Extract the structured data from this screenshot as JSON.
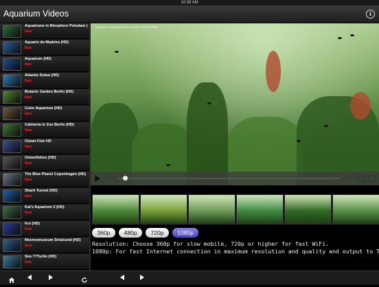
{
  "status": {
    "time": "10:38 AM",
    "carrier": "",
    "battery": ""
  },
  "header": {
    "title": "Aquarium Videos",
    "info_icon": "info-icon"
  },
  "sidebar": {
    "items": [
      {
        "title": "Aquariums in Biosphere Potsdam (HD)",
        "badge": "New",
        "thumb_color": "#2d6b3a"
      },
      {
        "title": "Aquario da Madeira (HD)",
        "badge": "New",
        "thumb_color": "#2a5f9e"
      },
      {
        "title": "Aquarium (HD)",
        "badge": "New",
        "thumb_color": "#1f4f8c"
      },
      {
        "title": "Atlantis Dubai (HD)",
        "badge": "New",
        "thumb_color": "#2e7fb8"
      },
      {
        "title": "Botanic Garden Berlin (HD)",
        "badge": "New",
        "thumb_color": "#4f8b2f"
      },
      {
        "title": "Color Aquarium (HD)",
        "badge": "New",
        "thumb_color": "#6a5a3a"
      },
      {
        "title": "Cafeteria in Zoo Berlin (HD)",
        "badge": "New",
        "thumb_color": "#3f7a2a"
      },
      {
        "title": "Clown Fish HD",
        "badge": "New",
        "thumb_color": "#3a4f8f"
      },
      {
        "title": "Clownfishes (HD)",
        "badge": "New",
        "thumb_color": "#555555"
      },
      {
        "title": "The Blue Planet Copenhagen (HD)",
        "badge": "New",
        "thumb_color": "#6b7a8a"
      },
      {
        "title": "Shark Tunnel (HD)",
        "badge": "New",
        "thumb_color": "#1f5fa8"
      },
      {
        "title": "Kai's Aquarium 2 (HD)",
        "badge": "New",
        "thumb_color": "#3a6f4a"
      },
      {
        "title": "Koi (HD)",
        "badge": "New",
        "thumb_color": "#2a3f9a"
      },
      {
        "title": "Meeresmuseum Stralsund (HD)",
        "badge": "New",
        "thumb_color": "#2f5f8a"
      },
      {
        "title": "Sea ??Turtle (HD)",
        "badge": "New",
        "thumb_color": "#3a7fa0"
      },
      {
        "title": "Sea Turtle Stralsund (HD)",
        "badge": "New",
        "thumb_color": "#2a6a8a"
      }
    ]
  },
  "player": {
    "video_title": "Aquarium im Botanischen Garten Berlin 1080p",
    "time_elapsed": "0:10",
    "time_remaining": "-1:03",
    "progress": 0.03
  },
  "thumbnails": [
    {
      "color": "#4d8a3a"
    },
    {
      "color": "#7aa03a"
    },
    {
      "color": "#6f9a5a"
    },
    {
      "color": "#3f8a45"
    },
    {
      "color": "#2f6a25"
    },
    {
      "color": "#5a8f4a"
    }
  ],
  "resolutions": {
    "items": [
      "360p",
      "480p",
      "720p",
      "1080p"
    ],
    "selected": "1080p"
  },
  "description": {
    "line1": "Resolution: Choose 360p for slow mobile, 720p or higher for fast WiFi.",
    "line2": "1080p: For fast Internet connection in maximum resolution and quality and output to TV."
  },
  "toolbar": {
    "icons": [
      "home-icon",
      "back-icon",
      "forward-icon",
      "refresh-icon",
      "prev-icon",
      "next-icon"
    ]
  }
}
